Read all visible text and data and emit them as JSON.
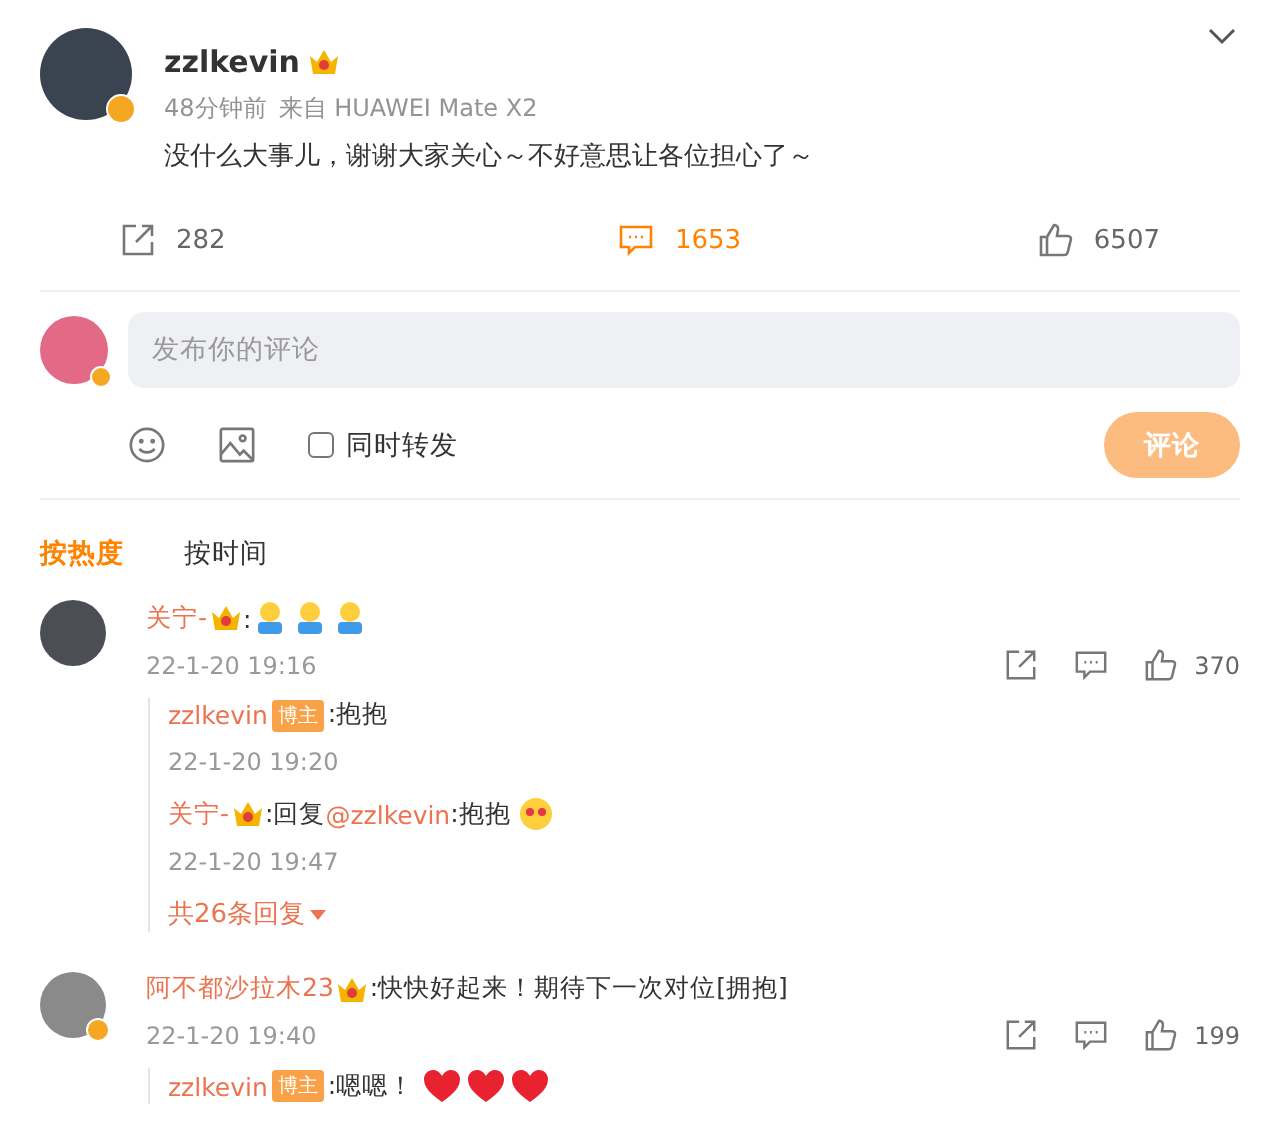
{
  "post": {
    "author": "zzlkevin",
    "verified": true,
    "vip": true,
    "time": "48分钟前",
    "source": "来自 HUAWEI Mate X2",
    "text": "没什么大事儿，谢谢大家关心～不好意思让各位担心了～",
    "actions": [
      {
        "kind": "share",
        "count": "282",
        "active": false
      },
      {
        "kind": "comment",
        "count": "1653",
        "active": true
      },
      {
        "kind": "like",
        "count": "6507",
        "active": false
      }
    ]
  },
  "composer": {
    "verified": true,
    "placeholder": "发布你的评论",
    "repost_label": "同时转发",
    "repost_checked": false,
    "submit": "评论",
    "submit_disabled": true
  },
  "sort_tabs": [
    {
      "label": "按热度",
      "selected": true
    },
    {
      "label": "按时间",
      "selected": false
    }
  ],
  "comments": [
    {
      "author": "关宁-",
      "verified": false,
      "vip": true,
      "text": ":",
      "emojis": [
        {
          "kind": "hug"
        },
        {
          "kind": "hug"
        },
        {
          "kind": "hug"
        }
      ],
      "time": "22-1-20 19:16",
      "likes": "370",
      "replies": [
        {
          "author": "zzlkevin",
          "badge": "博主",
          "text": ":抱抱",
          "time": "22-1-20 19:20"
        },
        {
          "author": "关宁-",
          "vip": true,
          "text": ":回复",
          "mention": "@zzlkevin",
          "after": ":抱抱",
          "emojis": [
            {
              "kind": "love"
            }
          ],
          "time": "22-1-20 19:47"
        }
      ],
      "more": "共26条回复"
    },
    {
      "author": "阿不都沙拉木23",
      "verified": true,
      "vip": true,
      "text": ":快快好起来！期待下一次对位[拥抱]",
      "time": "22-1-20 19:40",
      "likes": "199",
      "replies": [
        {
          "author": "zzlkevin",
          "badge": "博主",
          "text": ":嗯嗯！",
          "emojis": [
            {
              "kind": "heart"
            },
            {
              "kind": "heart"
            },
            {
              "kind": "heart"
            }
          ]
        }
      ]
    }
  ]
}
